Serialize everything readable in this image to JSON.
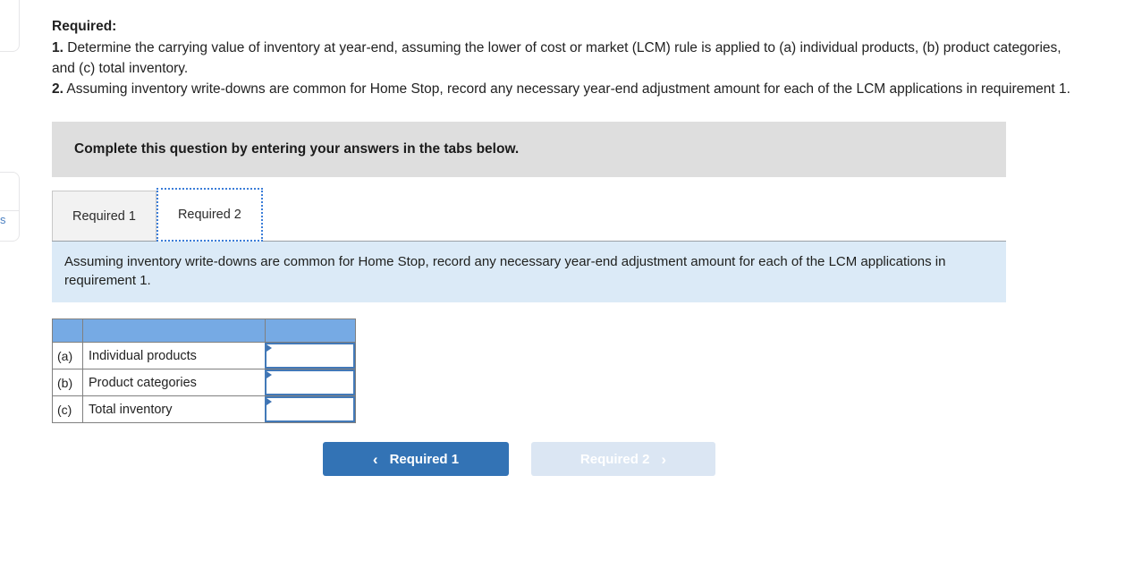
{
  "left_rail": {
    "link_fragment": "s"
  },
  "problem": {
    "heading": "Required:",
    "items": [
      {
        "number": "1.",
        "text": " Determine the carrying value of inventory at year-end, assuming the lower of cost or market (LCM) rule is applied to (a) individual products, (b) product categories, and (c) total inventory."
      },
      {
        "number": "2.",
        "text": " Assuming inventory write-downs are common for Home Stop, record any necessary year-end adjustment amount for each of the LCM applications in requirement 1."
      }
    ]
  },
  "instruction_banner": {
    "text": "Complete this question by entering your answers in the tabs below."
  },
  "tabs": [
    {
      "label": "Required 1",
      "active": false
    },
    {
      "label": "Required 2",
      "active": true
    }
  ],
  "info_box": {
    "text": "Assuming inventory write-downs are common for Home Stop, record any necessary year-end adjustment amount for each of the LCM applications in requirement 1."
  },
  "answer_table": {
    "header": {
      "letter": "",
      "label": "",
      "value": ""
    },
    "rows": [
      {
        "letter": "(a)",
        "label": "Individual products",
        "value": "",
        "placeholder": ""
      },
      {
        "letter": "(b)",
        "label": "Product categories",
        "value": "",
        "placeholder": ""
      },
      {
        "letter": "(c)",
        "label": "Total inventory",
        "value": "",
        "placeholder": ""
      }
    ]
  },
  "nav": {
    "prev": {
      "label": "Required 1",
      "chevron": "‹"
    },
    "next": {
      "label": "Required 2",
      "chevron": "›"
    }
  },
  "colors": {
    "banner_gray": "#dedede",
    "info_blue": "#dbeaf7",
    "table_header_blue": "#76aae4",
    "button_blue": "#3373b5",
    "button_disabled_blue": "#dbe6f3",
    "input_border_blue": "#4279b8",
    "tab_focus_blue": "#3b7dd8"
  }
}
